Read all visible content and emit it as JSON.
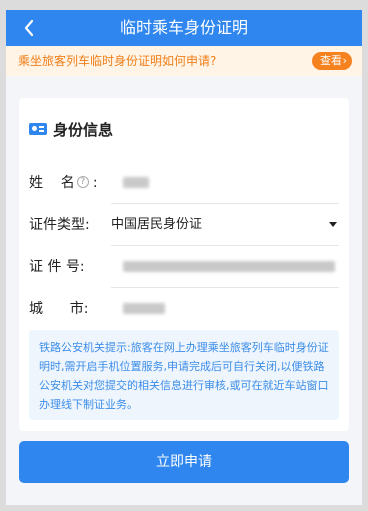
{
  "header": {
    "title": "临时乘车身份证明",
    "back_icon": "chevron-left-icon"
  },
  "notice": {
    "text": "乘坐旅客列车临时身份证明如何申请?",
    "action_label": "查看",
    "action_icon": "chevron-right-icon"
  },
  "card": {
    "heading": "身份信息",
    "heading_icon": "id-card-icon",
    "fields": {
      "name": {
        "label": "姓    名",
        "colon": ":",
        "help_icon": "question-circle-icon"
      },
      "id_type": {
        "label": "证件类型:",
        "value": "中国居民身份证"
      },
      "id_number": {
        "label": "证 件 号:"
      },
      "city": {
        "label": "城      市:"
      }
    },
    "hint": "铁路公安机关提示:旅客在网上办理乘坐旅客列车临时身份证明时,需开启手机位置服务,申请完成后可自行关闭,以便铁路公安机关对您提交的相关信息进行审核,或可在就近车站窗口办理线下制证业务。"
  },
  "submit": {
    "label": "立即申请"
  },
  "colors": {
    "primary": "#2e86ee",
    "notice_bg": "#fff4e6",
    "notice_text": "#f07f1a",
    "chip_bg": "#f5821f",
    "hint_bg": "#eef5fd",
    "hint_text": "#3c8de8"
  }
}
